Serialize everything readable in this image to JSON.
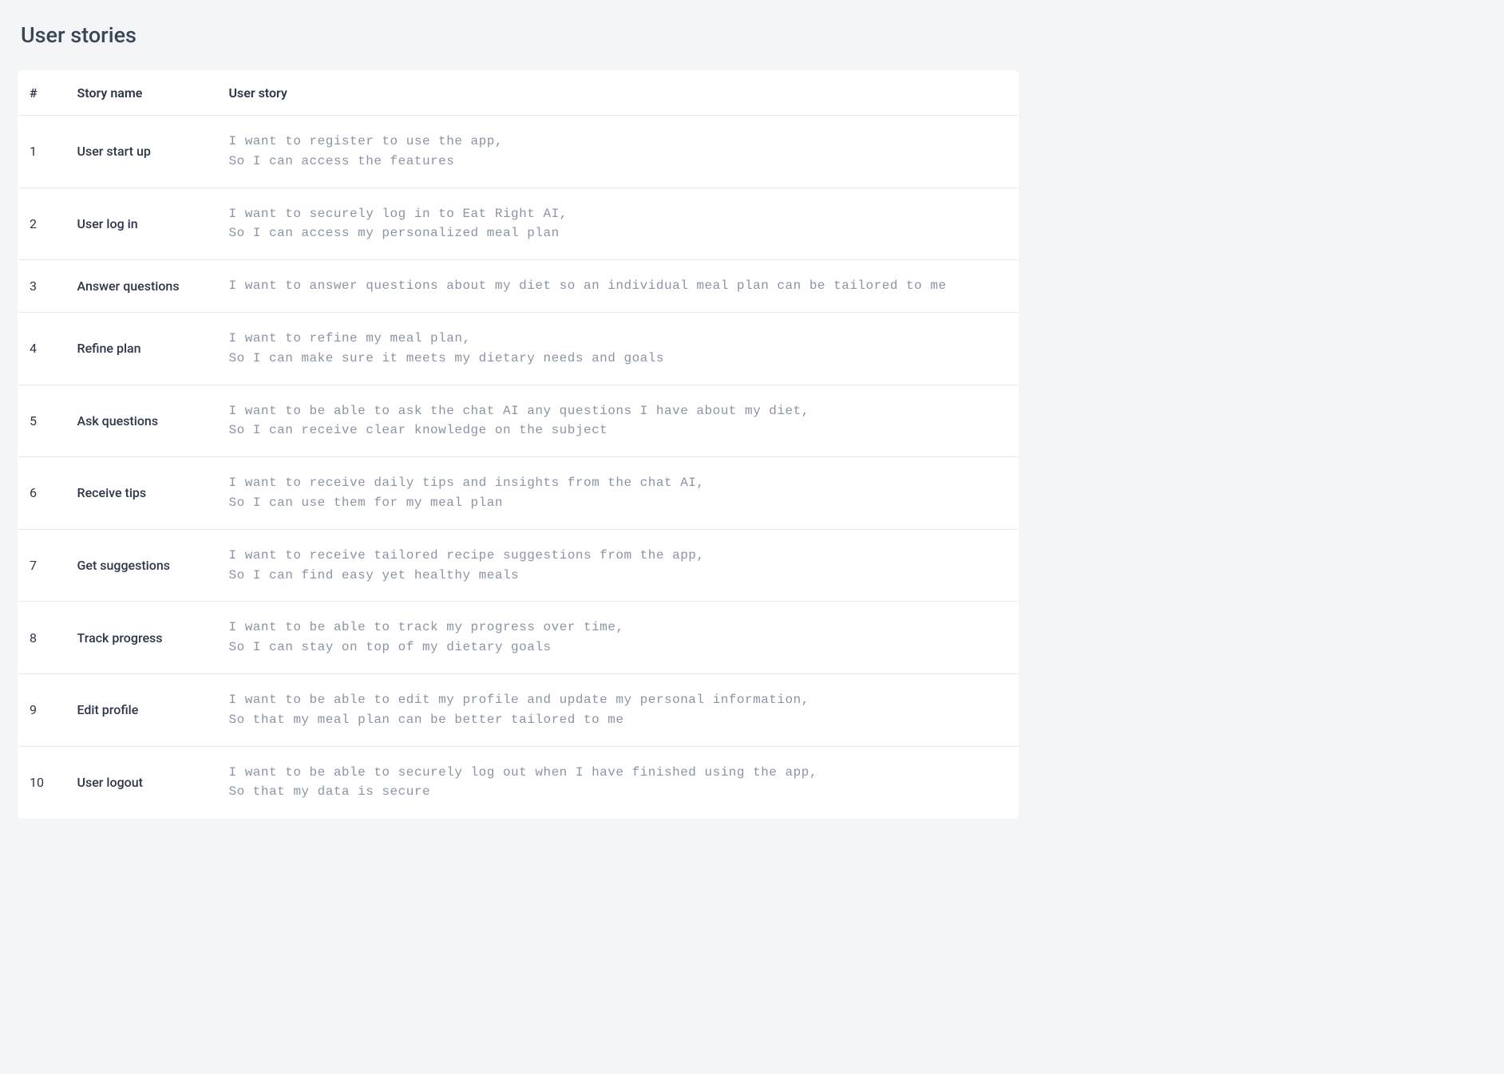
{
  "title": "User stories",
  "columns": {
    "num": "#",
    "name": "Story name",
    "story": "User story"
  },
  "rows": [
    {
      "num": "1",
      "name": "User start up",
      "story": "I want to register to use the app,\nSo I can access the features"
    },
    {
      "num": "2",
      "name": "User log in",
      "story": "I want to securely log in to Eat Right AI,\nSo I can access my personalized meal plan"
    },
    {
      "num": "3",
      "name": "Answer questions",
      "story": "I want to answer questions about my diet so an individual meal plan can be tailored to me"
    },
    {
      "num": "4",
      "name": "Refine plan",
      "story": "I want to refine my meal plan,\nSo I can make sure it meets my dietary needs and goals"
    },
    {
      "num": "5",
      "name": "Ask questions",
      "story": "I want to be able to ask the chat AI any questions I have about my diet,\nSo I can receive clear knowledge on the subject"
    },
    {
      "num": "6",
      "name": "Receive tips",
      "story": "I want to receive daily tips and insights from the chat AI,\nSo I can use them for my meal plan"
    },
    {
      "num": "7",
      "name": "Get suggestions",
      "story": "I want to receive tailored recipe suggestions from the app,\nSo I can find easy yet healthy meals"
    },
    {
      "num": "8",
      "name": "Track progress",
      "story": "I want to be able to track my progress over time,\nSo I can stay on top of my dietary goals"
    },
    {
      "num": "9",
      "name": "Edit profile",
      "story": "I want to be able to edit my profile and update my personal information,\nSo that my meal plan can be better tailored to me"
    },
    {
      "num": "10",
      "name": "User logout",
      "story": "I want to be able to securely log out when I have finished using the app,\nSo that my data is secure"
    }
  ]
}
